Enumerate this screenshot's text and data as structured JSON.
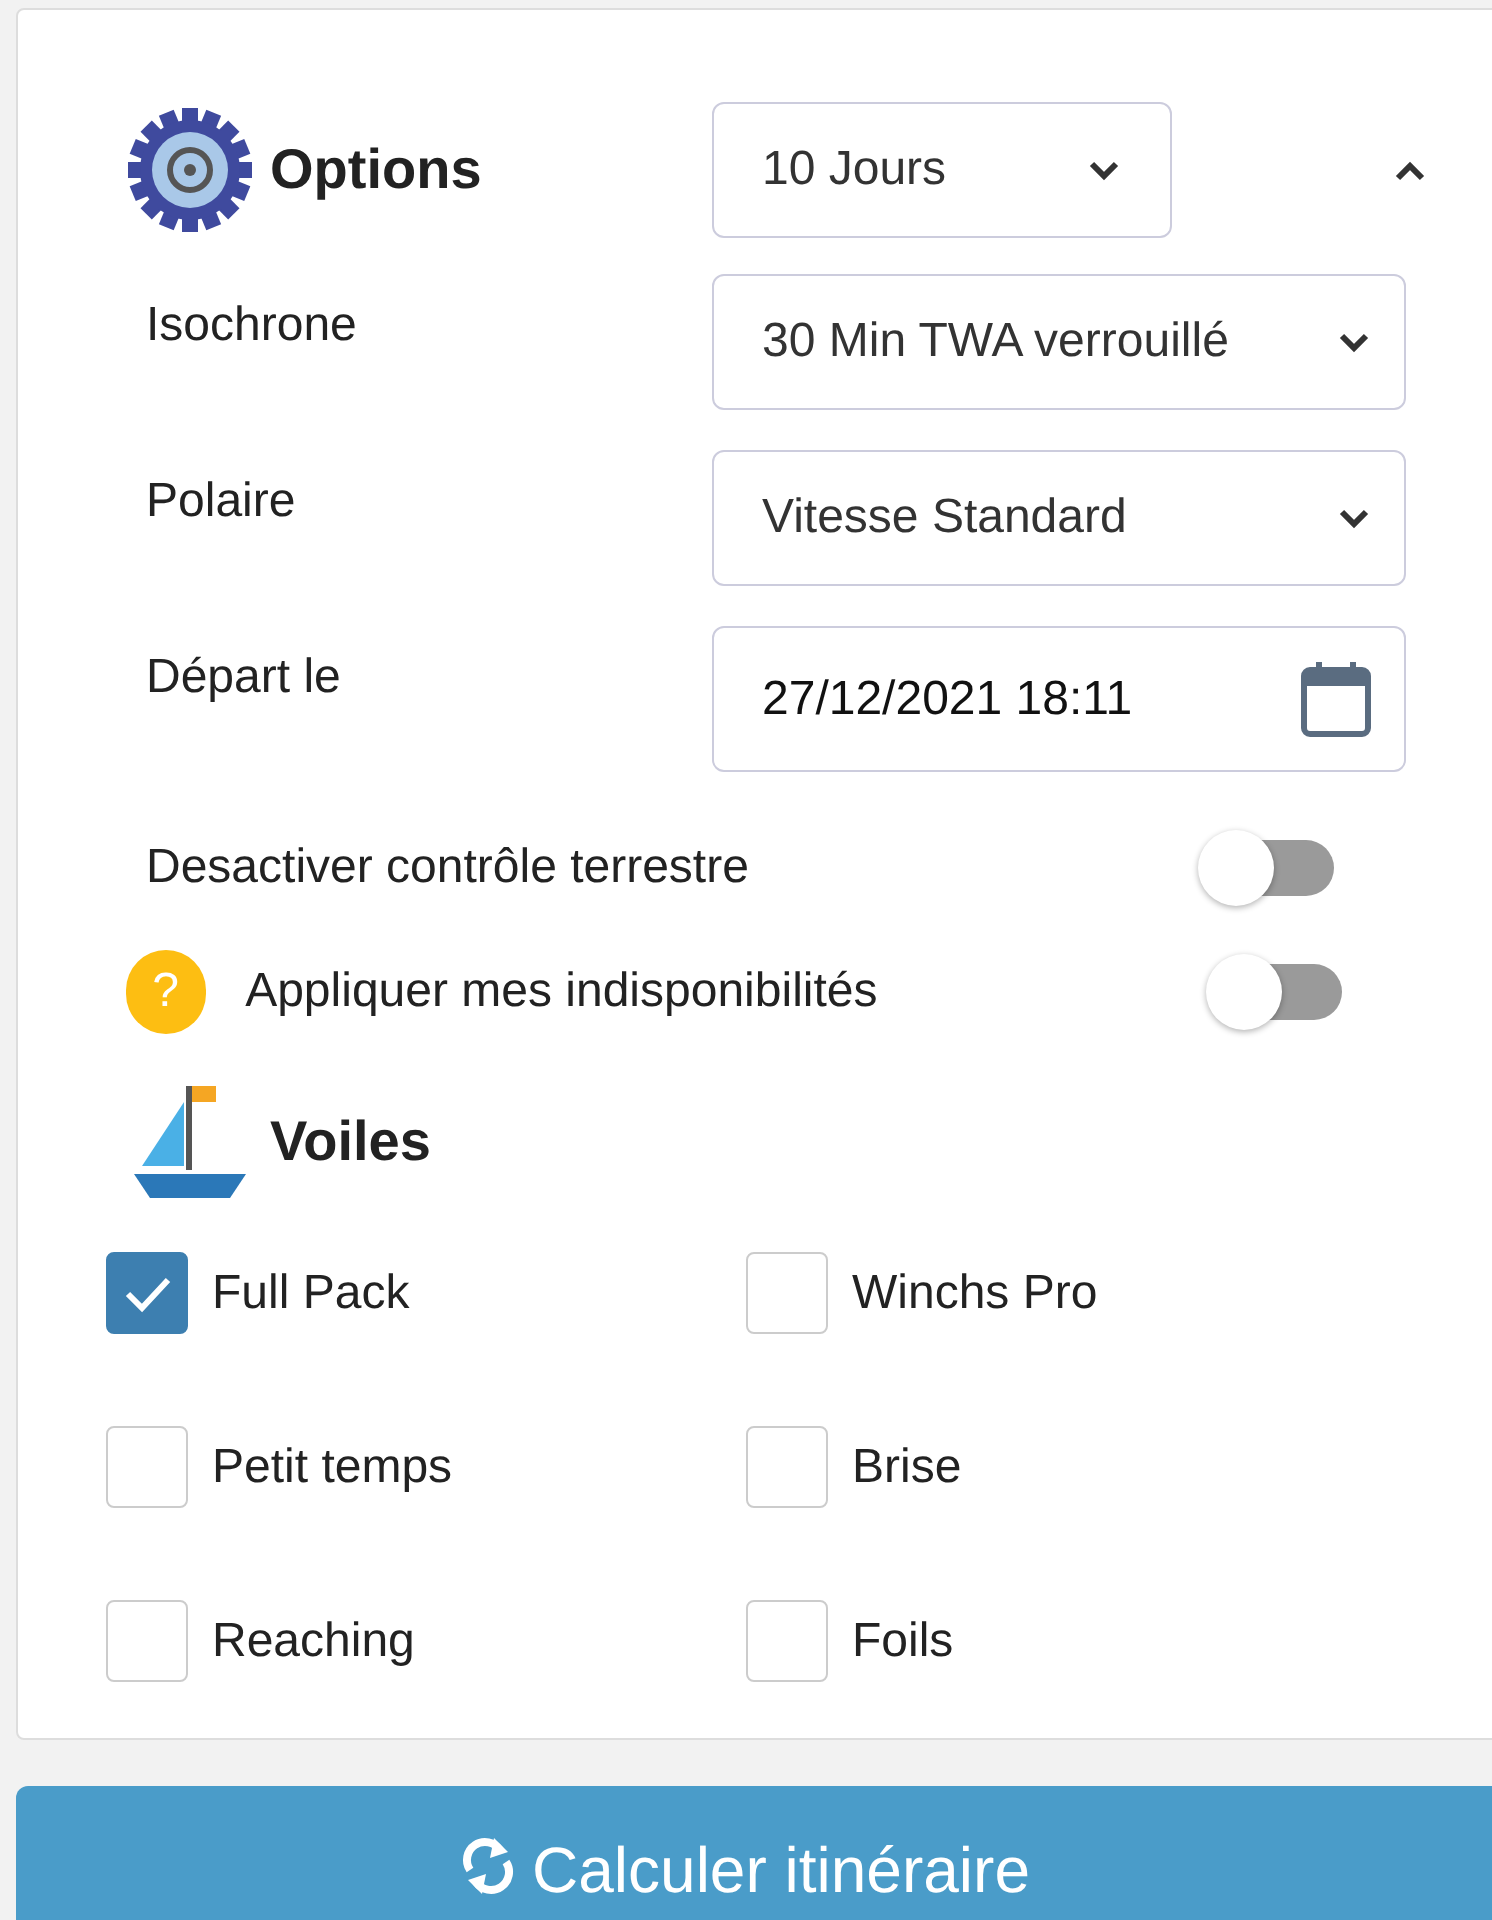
{
  "options": {
    "title": "Options",
    "duration": {
      "value": "10 Jours"
    },
    "expanded": true
  },
  "fields": [
    {
      "label": "Isochrone",
      "kind": "select",
      "value": "30 Min TWA verrouillé"
    },
    {
      "label": "Polaire",
      "kind": "select",
      "value": "Vitesse Standard"
    },
    {
      "label": "Départ le",
      "kind": "date",
      "value": "27/12/2021 18:11"
    }
  ],
  "toggles": [
    {
      "label": "Desactiver contrôle terrestre",
      "on": false
    },
    {
      "label": "Appliquer mes indisponibilités",
      "on": false,
      "help": "?"
    }
  ],
  "sails": {
    "title": "Voiles",
    "items": [
      {
        "label": "Full Pack",
        "checked": true
      },
      {
        "label": "Winchs Pro",
        "checked": false
      },
      {
        "label": "Petit temps",
        "checked": false
      },
      {
        "label": "Brise",
        "checked": false
      },
      {
        "label": "Reaching",
        "checked": false
      },
      {
        "label": "Foils",
        "checked": false
      }
    ]
  },
  "submit": {
    "label": "Calculer itinéraire"
  }
}
